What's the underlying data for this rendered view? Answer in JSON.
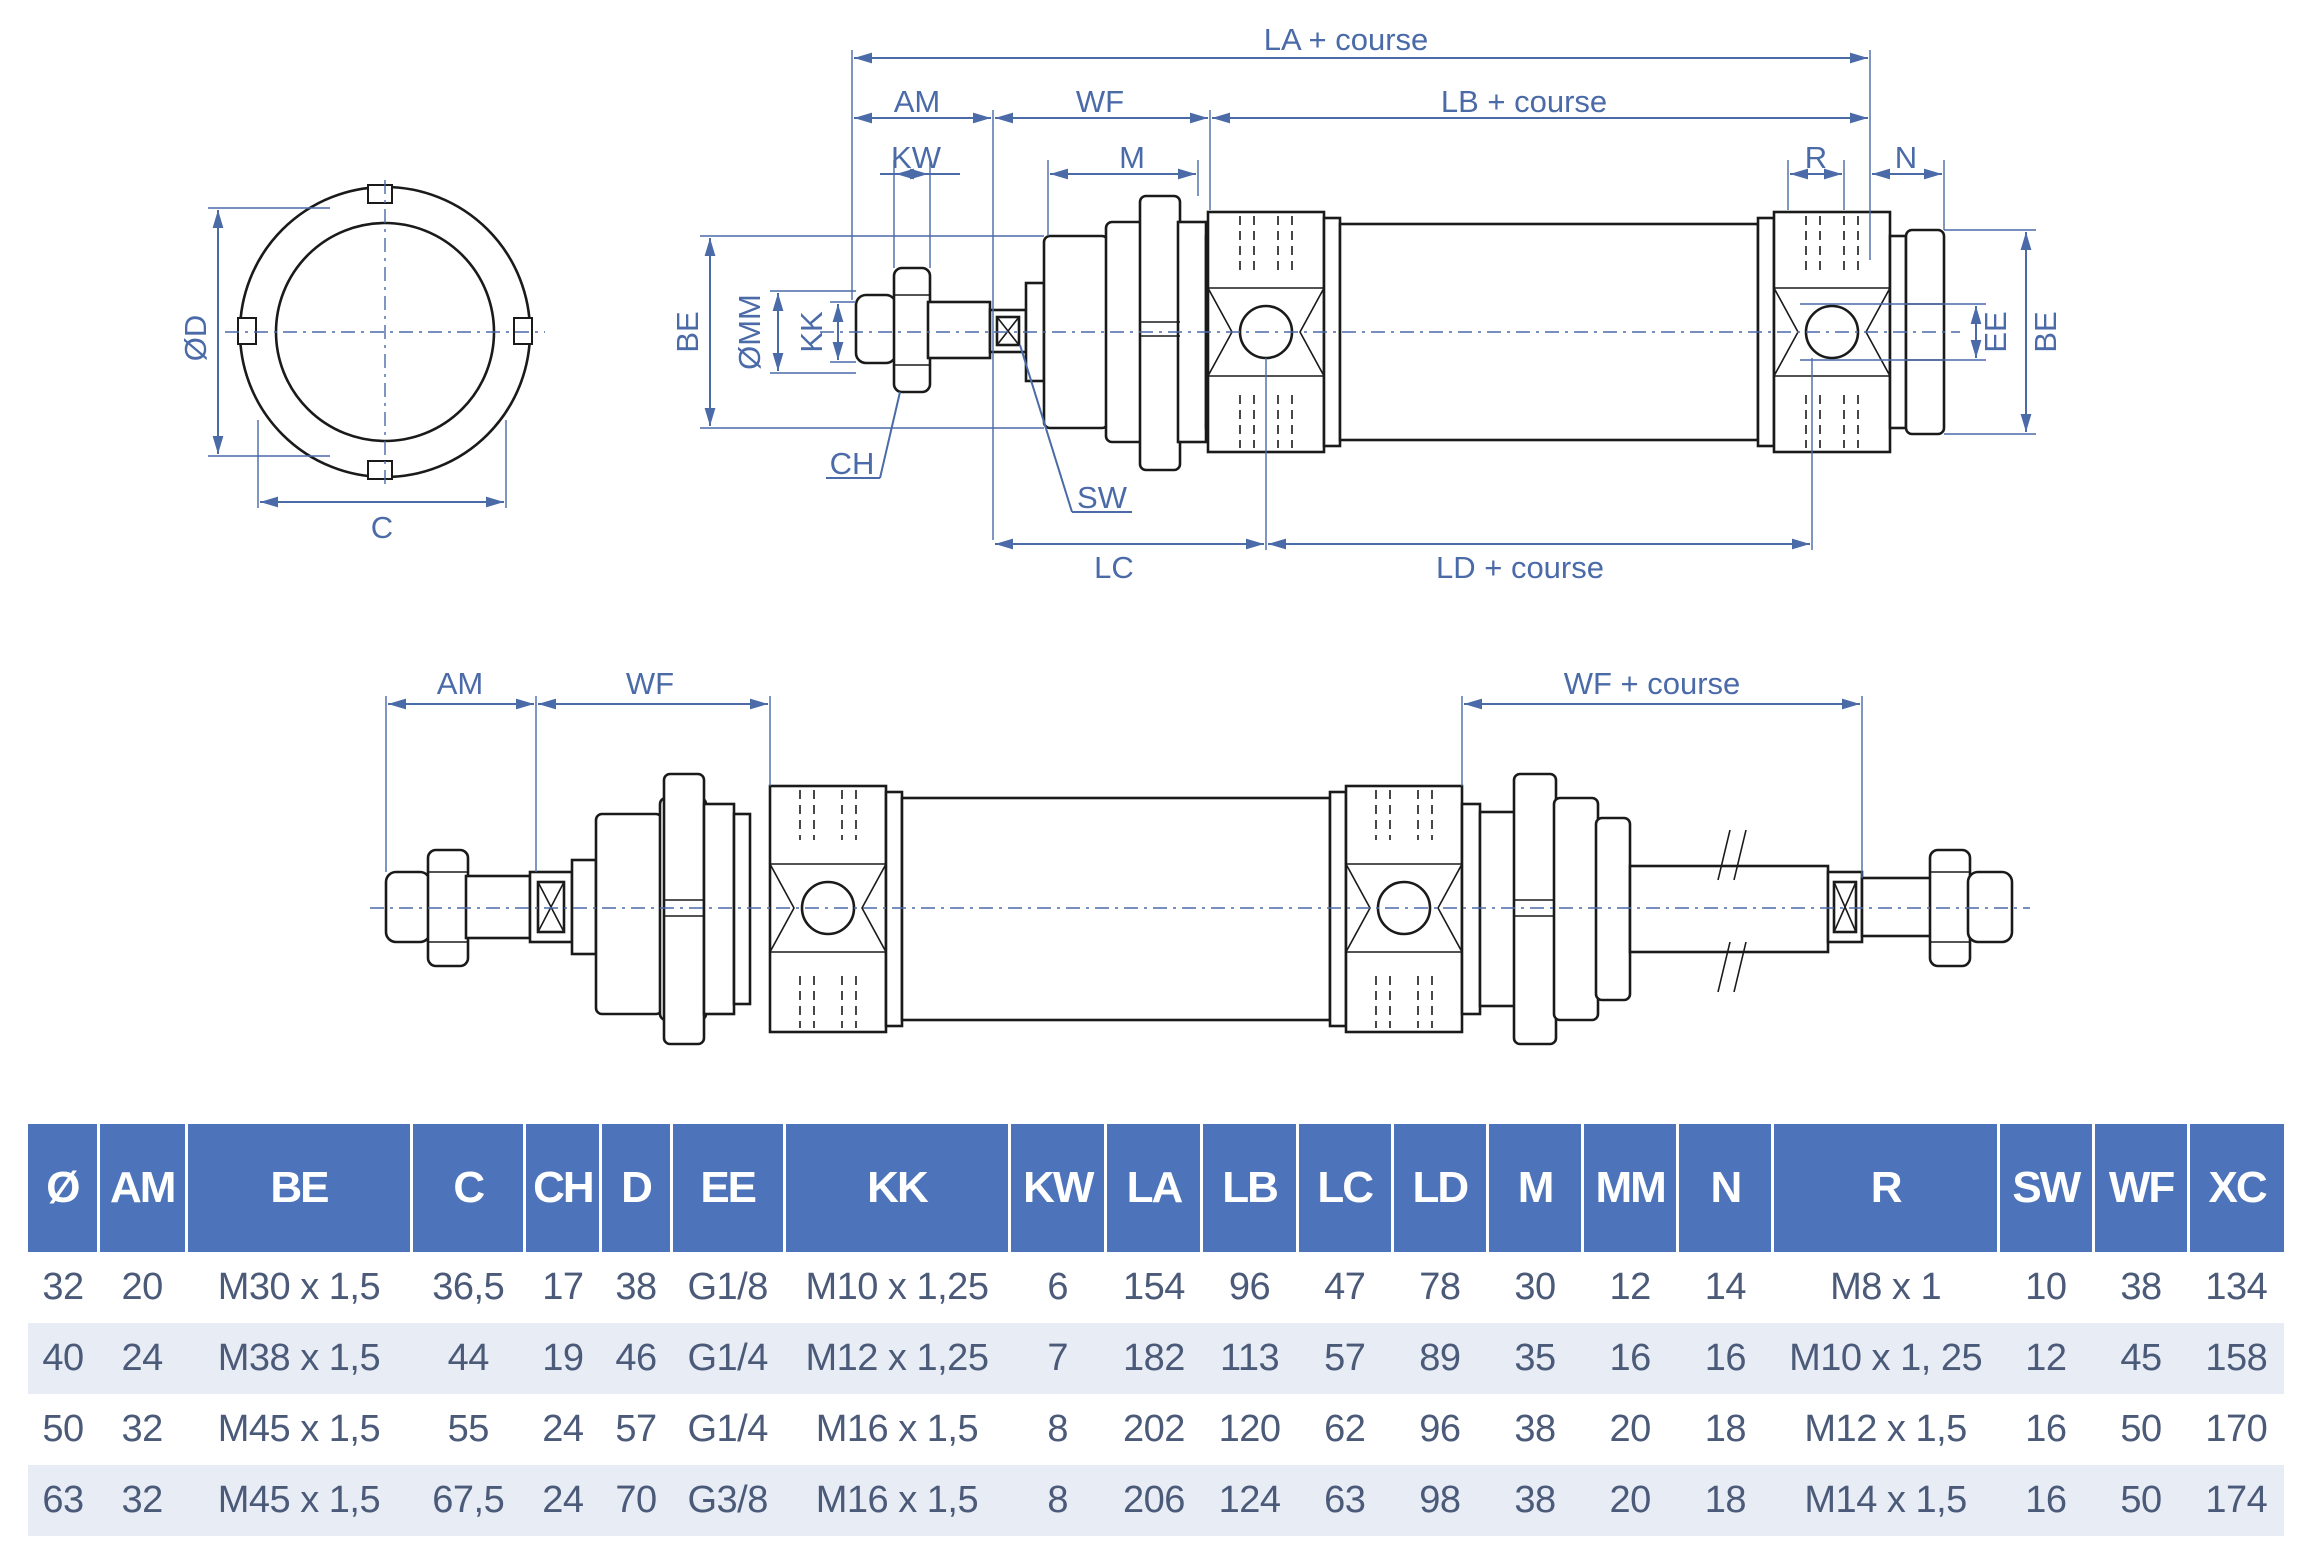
{
  "drawing": {
    "front_view": {
      "dia_label": "ØD",
      "width_label": "C"
    },
    "side_view": {
      "la": "LA + course",
      "am": "AM",
      "wf": "WF",
      "lb": "LB + course",
      "kw": "KW",
      "m": "M",
      "r": "R",
      "n": "N",
      "be_left": "BE",
      "mm": "ØMM",
      "kk": "KK",
      "ch": "CH",
      "sw": "SW",
      "lc": "LC",
      "ld": "LD + course",
      "ee": "EE",
      "be_right": "BE"
    },
    "through_rod_view": {
      "am": "AM",
      "wf": "WF",
      "wf_course": "WF + course"
    }
  },
  "table": {
    "headers": [
      "Ø",
      "AM",
      "BE",
      "C",
      "CH",
      "D",
      "EE",
      "KK",
      "KW",
      "LA",
      "LB",
      "LC",
      "LD",
      "M",
      "MM",
      "N",
      "R",
      "SW",
      "WF",
      "XC"
    ],
    "rows": [
      [
        "32",
        "20",
        "M30 x 1,5",
        "36,5",
        "17",
        "38",
        "G1/8",
        "M10 x 1,25",
        "6",
        "154",
        "96",
        "47",
        "78",
        "30",
        "12",
        "14",
        "M8 x 1",
        "10",
        "38",
        "134"
      ],
      [
        "40",
        "24",
        "M38 x 1,5",
        "44",
        "19",
        "46",
        "G1/4",
        "M12 x 1,25",
        "7",
        "182",
        "113",
        "57",
        "89",
        "35",
        "16",
        "16",
        "M10 x 1, 25",
        "12",
        "45",
        "158"
      ],
      [
        "50",
        "32",
        "M45 x 1,5",
        "55",
        "24",
        "57",
        "G1/4",
        "M16 x 1,5",
        "8",
        "202",
        "120",
        "62",
        "96",
        "38",
        "20",
        "18",
        "M12 x 1,5",
        "16",
        "50",
        "170"
      ],
      [
        "63",
        "32",
        "M45 x 1,5",
        "67,5",
        "24",
        "70",
        "G3/8",
        "M16 x 1,5",
        "8",
        "206",
        "124",
        "63",
        "98",
        "38",
        "20",
        "18",
        "M14 x 1,5",
        "16",
        "50",
        "174"
      ]
    ]
  },
  "colors": {
    "header_bg": "#4d74bb",
    "stripe_bg": "#e7ecf5",
    "dimension_blue": "#4a6aa8"
  }
}
